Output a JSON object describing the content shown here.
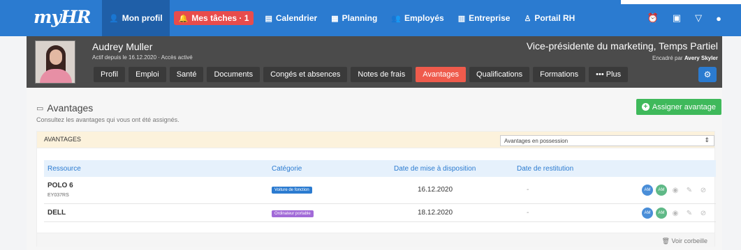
{
  "app": {
    "logo": "myHR"
  },
  "nav": [
    {
      "label": "Mon profil",
      "icon": "user-icon",
      "glyph": "👤"
    },
    {
      "label": "Mes tâches · 1",
      "icon": "bell-icon",
      "glyph": "🔔"
    },
    {
      "label": "Calendrier",
      "icon": "calendar-icon",
      "glyph": "▤"
    },
    {
      "label": "Planning",
      "icon": "planning-icon",
      "glyph": "▦"
    },
    {
      "label": "Employés",
      "icon": "employees-icon",
      "glyph": "👥"
    },
    {
      "label": "Entreprise",
      "icon": "building-icon",
      "glyph": "▥"
    },
    {
      "label": "Portail RH",
      "icon": "portal-icon",
      "glyph": "♙"
    }
  ],
  "right_icons": [
    "alarm-clock-icon",
    "clipboard-icon",
    "filter-icon",
    "user-icon"
  ],
  "user": {
    "name": "Audrey Muller",
    "status": "Actif depuis le 16.12.2020 · Accès activé",
    "job": "Vice-présidente du marketing, Temps Partiel",
    "supervisor_prefix": "Encadré par",
    "supervisor_name": "Avery Skyler"
  },
  "tabs": [
    "Profil",
    "Emploi",
    "Santé",
    "Documents",
    "Congés et absences",
    "Notes de frais",
    "Avantages",
    "Qualifications",
    "Formations",
    "••• Plus"
  ],
  "active_tab": "Avantages",
  "section": {
    "title": "Avantages",
    "description": "Consultez les avantages qui vous ont été assignés.",
    "add_button": "Assigner avantage"
  },
  "panel": {
    "heading": "AVANTAGES",
    "filter_selected": "Avantages en possession"
  },
  "table": {
    "columns": [
      "Ressource",
      "Catégorie",
      "Date de mise à disposition",
      "Date de restitution"
    ],
    "rows": [
      {
        "name": "POLO 6",
        "ref": "EY037RS",
        "category": "Voiture de fonction",
        "category_color": "#2b7bd0",
        "date_start": "16.12.2020",
        "date_end": "-",
        "avatars": [
          "AM",
          "AM"
        ]
      },
      {
        "name": "DELL",
        "ref": "",
        "category": "Ordinateur portable",
        "category_color": "#a26ad8",
        "date_start": "18.12.2020",
        "date_end": "-",
        "avatars": [
          "AM",
          "AM"
        ]
      }
    ]
  },
  "footer": {
    "trash_link": "Voir corbeille"
  }
}
